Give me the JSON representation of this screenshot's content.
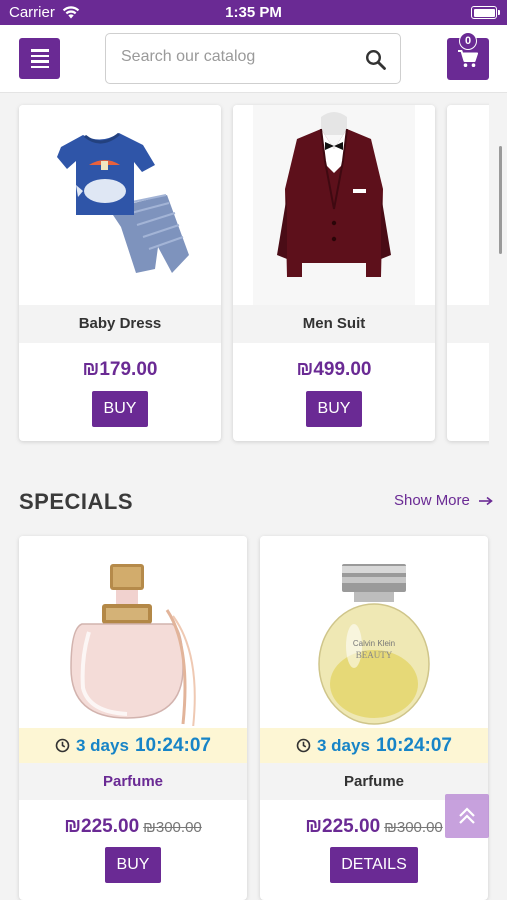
{
  "status_bar": {
    "carrier": "Carrier",
    "time": "1:35 PM"
  },
  "header": {
    "search_placeholder": "Search our catalog",
    "cart_count": "0"
  },
  "products": [
    {
      "name": "Baby Dress",
      "price": "₪179.00",
      "button": "BUY"
    },
    {
      "name": "Men Suit",
      "price": "₪499.00",
      "button": "BUY"
    }
  ],
  "specials": {
    "title": "SPECIALS",
    "show_more": "Show More",
    "items": [
      {
        "days": "3 days",
        "clock": "10:24:07",
        "name": "Parfume",
        "price": "₪225.00",
        "old_price": "₪300.00",
        "button": "BUY"
      },
      {
        "days": "3 days",
        "clock": "10:24:07",
        "name": "Parfume",
        "price": "₪225.00",
        "old_price": "₪300.00",
        "button": "DETAILS"
      }
    ]
  },
  "colors": {
    "accent": "#6a2a94",
    "countdown_text": "#1784c7",
    "countdown_bg": "#fdf6d4"
  }
}
